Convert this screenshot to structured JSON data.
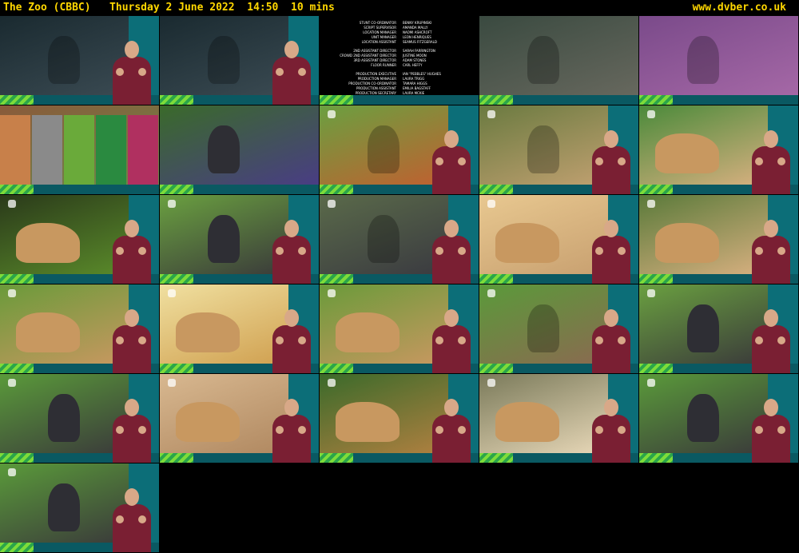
{
  "header": {
    "title": "The Zoo (CBBC)   Thursday 2 June 2022  14:50  10 mins",
    "site": "www.dvber.co.uk"
  },
  "credits": [
    [
      "STUNT CO-ORDINATOR",
      "BENNY KRUPINSKI"
    ],
    [
      "SCRIPT SUPERVISOR",
      "AMANDA MALLY"
    ],
    [
      "LOCATION MANAGER",
      "NAOMI ASHCROFT"
    ],
    [
      "UNIT MANAGER",
      "LEON HENRIQUES"
    ],
    [
      "LOCATION ASSISTANT",
      "SEAMUS FITZGERALD"
    ],
    [
      "2ND ASSISTANT DIRECTOR",
      "SARAH FARRINGTON"
    ],
    [
      "CROWD 2ND ASSISTANT DIRECTOR",
      "JUSTINE MOON"
    ],
    [
      "3RD ASSISTANT DIRECTOR",
      "ADAM STONES"
    ],
    [
      "FLOOR RUNNER",
      "CARL HEFFY"
    ],
    [
      "PRODUCTION EXECUTIVE",
      "IAN \"PEBBLES\" HUGHES"
    ],
    [
      "PRODUCTION MANAGER",
      "LAURA TRIGG"
    ],
    [
      "PRODUCTION CO-ORDINATOR",
      "TAMARA HIGGS"
    ],
    [
      "PRODUCTION ASSISTANT",
      "EMILIA BAGSTAFF"
    ],
    [
      "PRODUCTION SECRETARY",
      "LAURA MCKIE"
    ]
  ],
  "thumbnails": [
    {
      "scene": "drama-actors",
      "colors": [
        "#1a2a30",
        "#3a4a52"
      ]
    },
    {
      "scene": "drama-actors",
      "colors": [
        "#1a2a30",
        "#3a4a52"
      ]
    },
    {
      "scene": "end-credits",
      "colors": [
        "#000000",
        "#000000"
      ]
    },
    {
      "scene": "cave-animation",
      "colors": [
        "#3a4a40",
        "#6a6a60"
      ]
    },
    {
      "scene": "bird-animation",
      "colors": [
        "#7a4a8a",
        "#a86aa8"
      ]
    },
    {
      "scene": "color-bars",
      "colors": [
        "#8a5a3a",
        "#6a8a4a"
      ]
    },
    {
      "scene": "gorilla",
      "colors": [
        "#3a6a2a",
        "#4a3a8a"
      ]
    },
    {
      "scene": "orangutan",
      "colors": [
        "#6aa040",
        "#c06030"
      ]
    },
    {
      "scene": "ducklings",
      "colors": [
        "#6a7a40",
        "#c0a070"
      ]
    },
    {
      "scene": "lions-resting",
      "colors": [
        "#4a8a3a",
        "#d8b080"
      ]
    },
    {
      "scene": "lion-shade",
      "colors": [
        "#2a3a1a",
        "#5a8a2a"
      ]
    },
    {
      "scene": "gorilla-closeup",
      "colors": [
        "#6aa040",
        "#3a3a3a"
      ]
    },
    {
      "scene": "visitors",
      "colors": [
        "#5a6a4a",
        "#3a3a40"
      ]
    },
    {
      "scene": "lion-cubs",
      "colors": [
        "#e8c890",
        "#c8a070"
      ]
    },
    {
      "scene": "lioness",
      "colors": [
        "#5a7a3a",
        "#d8b080"
      ]
    },
    {
      "scene": "lioness-grass",
      "colors": [
        "#6a9a3a",
        "#c89860"
      ]
    },
    {
      "scene": "lion-bright",
      "colors": [
        "#f0e0a0",
        "#d0a050"
      ]
    },
    {
      "scene": "lioness-grass",
      "colors": [
        "#6a9a3a",
        "#c89860"
      ]
    },
    {
      "scene": "enclosure",
      "colors": [
        "#5a9a3a",
        "#8a6a50"
      ]
    },
    {
      "scene": "gorilla-walking",
      "colors": [
        "#6aa040",
        "#3a3a3a"
      ]
    },
    {
      "scene": "gorilla-standing",
      "colors": [
        "#5a9a3a",
        "#3a3a3a"
      ]
    },
    {
      "scene": "lion-family",
      "colors": [
        "#d8b890",
        "#b08860"
      ]
    },
    {
      "scene": "lion-male",
      "colors": [
        "#3a6a2a",
        "#b08040"
      ]
    },
    {
      "scene": "white-lioness",
      "colors": [
        "#7a7a5a",
        "#e8d8b8"
      ]
    },
    {
      "scene": "gorilla-pool",
      "colors": [
        "#5a9a3a",
        "#3a3a3a"
      ]
    },
    {
      "scene": "gorilla-grass",
      "colors": [
        "#5a9a3a",
        "#3a3a3a"
      ]
    }
  ]
}
